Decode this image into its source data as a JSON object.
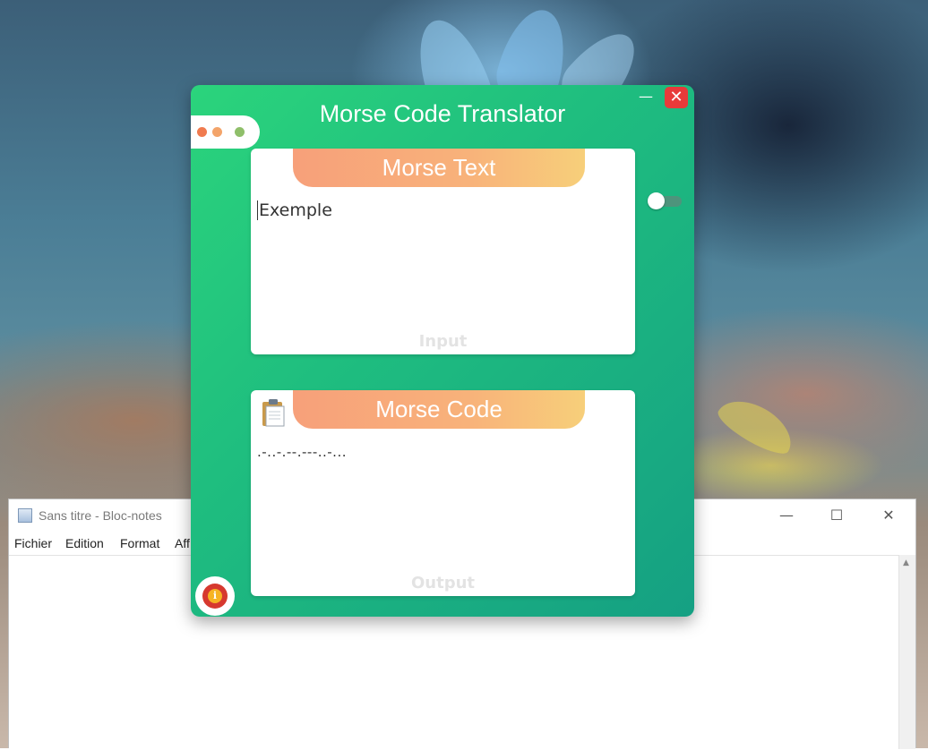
{
  "notepad": {
    "title": "Sans titre - Bloc-notes",
    "menu": [
      "Fichier",
      "Edition",
      "Format",
      "Aff"
    ],
    "minimize_glyph": "—",
    "maximize_glyph": "☐",
    "close_glyph": "✕"
  },
  "app": {
    "title": "Morse Code Translator",
    "minimize_glyph": "—",
    "close_glyph": "✕",
    "dot_colors": [
      "#f07b4f",
      "#f3a46a",
      "#8fbf6a"
    ],
    "toggle_on": false,
    "input": {
      "header": "Morse Text",
      "value": "Exemple",
      "footer": "Input"
    },
    "output": {
      "header": "Morse Code",
      "value": ".-..-.--.---..-...",
      "footer": "Output",
      "clipboard_icon": "clipboard-icon"
    },
    "info_icon": "info-icon",
    "info_glyph": "i"
  }
}
